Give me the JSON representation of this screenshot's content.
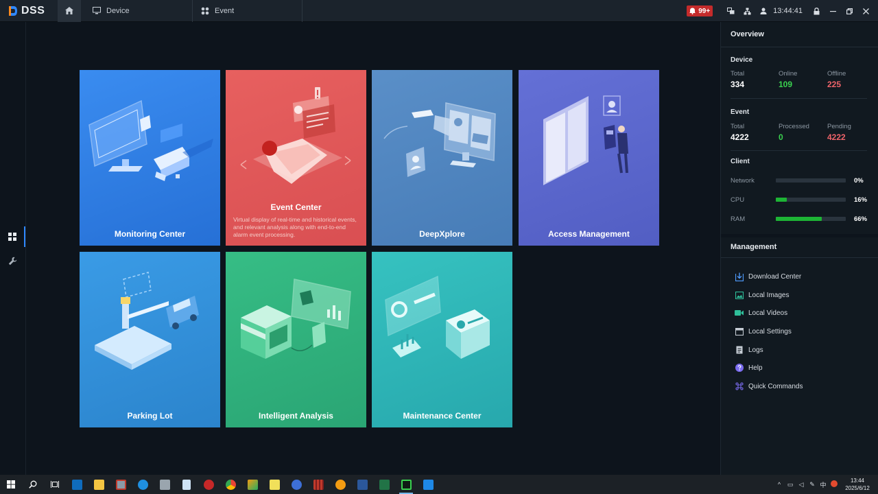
{
  "app": {
    "name": "DSS"
  },
  "tabs": [
    {
      "label": "Device",
      "icon": "monitor-icon"
    },
    {
      "label": "Event",
      "icon": "grid-icon"
    }
  ],
  "topbar": {
    "alarm_count": "99+",
    "time": "13:44:41"
  },
  "tiles": [
    {
      "label": "Monitoring Center",
      "color": "#2f7fe3"
    },
    {
      "label": "Event Center",
      "color": "#e0575a",
      "description": "Virtual display of real-time and historical events, and relevant analysis along with end-to-end alarm event processing."
    },
    {
      "label": "DeepXplore",
      "color": "#4f86c0"
    },
    {
      "label": "Access Management",
      "color": "#5b66cc"
    },
    {
      "label": "Parking Lot",
      "color": "#2d8fd8"
    },
    {
      "label": "Intelligent Analysis",
      "color": "#2fb07c"
    },
    {
      "label": "Maintenance Center",
      "color": "#2cb1b3"
    }
  ],
  "overview": {
    "title": "Overview",
    "device": {
      "title": "Device",
      "total_label": "Total",
      "total": "334",
      "online_label": "Online",
      "online": "109",
      "offline_label": "Offline",
      "offline": "225"
    },
    "event": {
      "title": "Event",
      "total_label": "Total",
      "total": "4222",
      "processed_label": "Processed",
      "processed": "0",
      "pending_label": "Pending",
      "pending": "4222"
    },
    "client": {
      "title": "Client",
      "network_label": "Network",
      "network": "0%",
      "network_level": 0,
      "cpu_label": "CPU",
      "cpu": "16%",
      "cpu_level": 16,
      "ram_label": "RAM",
      "ram": "66%",
      "ram_level": 66
    }
  },
  "management": {
    "title": "Management",
    "items": [
      {
        "label": "Download Center",
        "icon": "download-icon"
      },
      {
        "label": "Local Images",
        "icon": "image-icon"
      },
      {
        "label": "Local Videos",
        "icon": "video-icon"
      },
      {
        "label": "Local Settings",
        "icon": "settings-icon"
      },
      {
        "label": "Logs",
        "icon": "log-icon"
      },
      {
        "label": "Help",
        "icon": "help-icon"
      },
      {
        "label": "Quick Commands",
        "icon": "command-icon"
      }
    ]
  },
  "taskbar": {
    "time": "13:44",
    "date": "2025/6/12",
    "ime": "中"
  },
  "colors": {
    "online": "#3ad14f",
    "offline": "#f0646a",
    "accent": "#2f88ff",
    "bar_fill": "#1db435"
  }
}
